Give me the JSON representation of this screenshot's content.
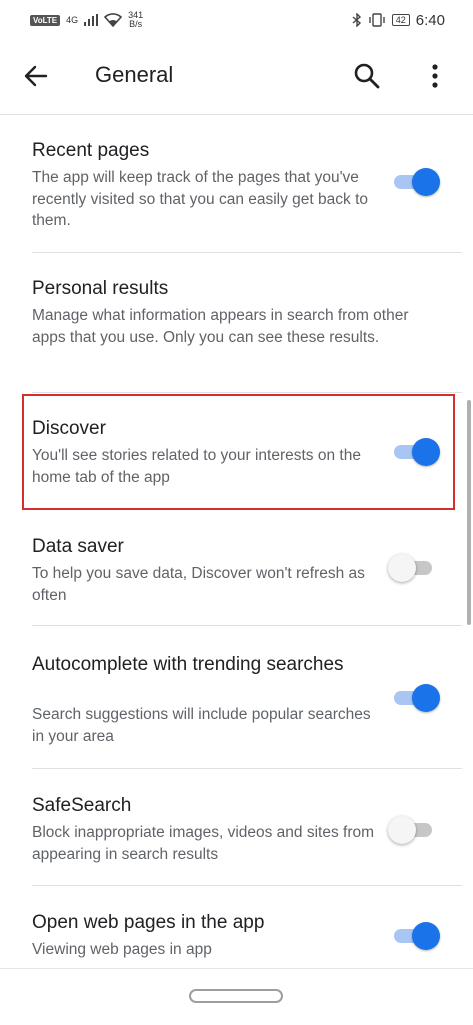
{
  "status_bar": {
    "volte": "VoLTE",
    "signal": "4G",
    "net_speed_value": "341",
    "net_speed_unit": "B/s",
    "battery": "42",
    "time": "6:40"
  },
  "app_bar": {
    "title": "General",
    "back_icon": "arrow-back-icon",
    "search_icon": "search-icon",
    "more_icon": "more-vert-icon"
  },
  "settings": [
    {
      "title": "Recent pages",
      "desc": "The app will keep track of the pages that you've recently visited so that you can easily get back to them.",
      "toggle": "on"
    },
    {
      "title": "Personal results",
      "desc": "Manage what information appears in search from other apps that you use. Only you can see these results.",
      "toggle": "none"
    },
    {
      "title": "Discover",
      "desc": "You'll see stories related to your interests on the home tab of the app",
      "toggle": "on"
    },
    {
      "title": "Data saver",
      "desc": "To help you save data, Discover won't refresh as often",
      "toggle": "off"
    },
    {
      "title": "Autocomplete with trending searches",
      "desc": "Search suggestions will include popular searches in your area",
      "toggle": "on"
    },
    {
      "title": "SafeSearch",
      "desc": "Block inappropriate images, videos and sites from appearing in search results",
      "toggle": "off"
    },
    {
      "title": "Open web pages in the app",
      "desc": "Viewing web pages in app",
      "toggle": "on"
    }
  ],
  "colors": {
    "accent": "#1a73e8",
    "highlight": "#d32f2f"
  }
}
